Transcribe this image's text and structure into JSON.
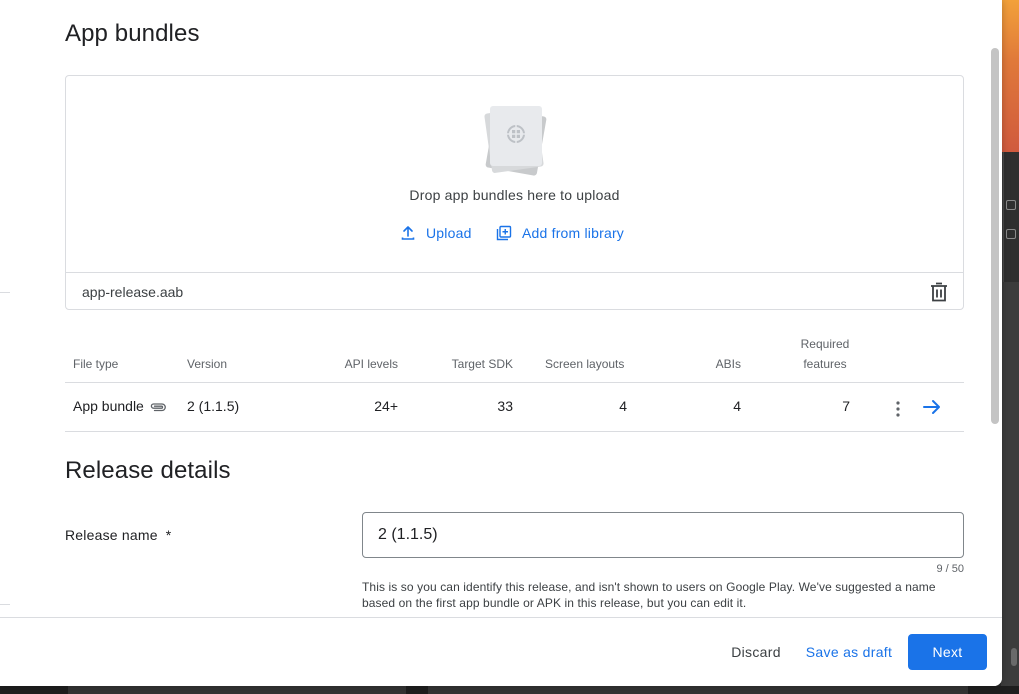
{
  "dialog": {
    "bundles_title": "App bundles",
    "release_title": "Release details"
  },
  "upload": {
    "drop_text": "Drop app bundles here to upload",
    "upload_label": "Upload",
    "library_label": "Add from library",
    "file_name": "app-release.aab"
  },
  "table": {
    "headers": {
      "file_type": "File type",
      "version": "Version",
      "api_levels": "API levels",
      "target_sdk": "Target SDK",
      "screen_layouts": "Screen layouts",
      "abis": "ABIs",
      "required_line1": "Required",
      "required_line2": "features"
    },
    "rows": [
      {
        "file_type": "App bundle",
        "version": "2 (1.1.5)",
        "api_levels": "24+",
        "target_sdk": "33",
        "screen_layouts": "4",
        "abis": "4",
        "required_features": "7"
      }
    ]
  },
  "release_name": {
    "label": "Release name",
    "required_mark": "*",
    "value": "2 (1.1.5)",
    "counter": "9 / 50",
    "helper": "This is so you can identify this release, and isn't shown to users on Google Play. We've suggested a name based on the first app bundle or APK in this release, but you can edit it."
  },
  "footer": {
    "discard": "Discard",
    "save_draft": "Save as draft",
    "next": "Next"
  },
  "icons": {
    "upload": "upload-icon",
    "library": "library-add-icon",
    "delete": "trash-icon",
    "attachment": "paperclip-icon",
    "more": "more-vert-icon",
    "details": "arrow-right-icon"
  },
  "colors": {
    "accent": "#1a73e8",
    "text": "#202124",
    "secondary_text": "#5f6368",
    "divider": "#dadce0"
  }
}
